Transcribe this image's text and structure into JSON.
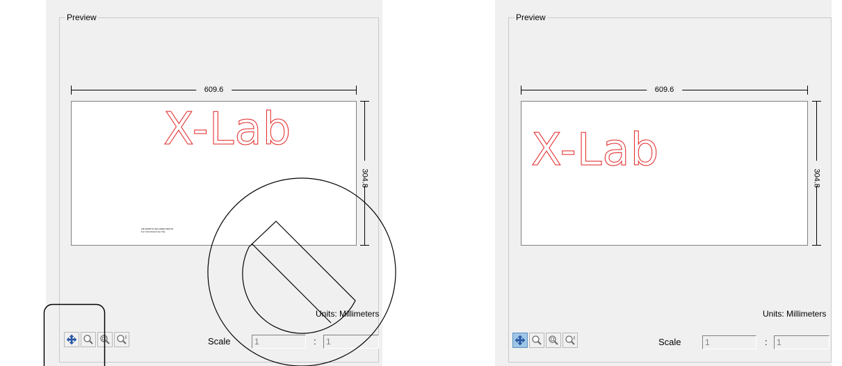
{
  "left_panel": {
    "group_title": "Preview",
    "width_dim": "609.6",
    "height_dim": "304.8",
    "design_text": "X-Lab",
    "fine_print": [
      "LIB SKRIPTS INCLUDED PRINTS",
      "For Instructional Use Only"
    ],
    "units": "Units: Millimeters",
    "scale_label": "Scale",
    "scale_left": "1",
    "scale_sep": ":",
    "scale_right": "1"
  },
  "right_panel": {
    "group_title": "Preview",
    "width_dim": "609.6",
    "height_dim": "304.8",
    "design_text": "X-Lab",
    "units": "Units: Millimeters",
    "scale_label": "Scale",
    "scale_left": "1",
    "scale_sep": ":",
    "scale_right": "1"
  },
  "toolbar": {
    "icons": [
      "pan-icon",
      "zoom-icon",
      "zoom-page-icon",
      "zoom-fit-icon"
    ]
  },
  "colors": {
    "design_stroke": "#e02020",
    "active_tool": "#9ec6e6"
  }
}
